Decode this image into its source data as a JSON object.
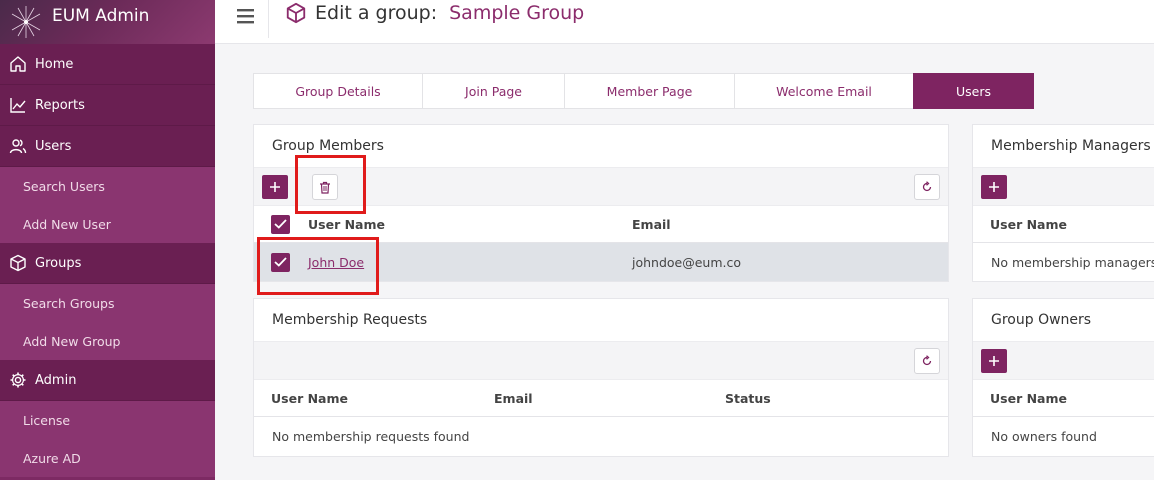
{
  "sidebar": {
    "brand": "EUM Admin",
    "nav": [
      {
        "type": "main",
        "icon": "home-icon",
        "label": "Home"
      },
      {
        "type": "main",
        "icon": "reports-icon",
        "label": "Reports"
      },
      {
        "type": "main",
        "icon": "users-icon",
        "label": "Users"
      },
      {
        "type": "sub",
        "label": "Search Users"
      },
      {
        "type": "sub",
        "label": "Add New User"
      },
      {
        "type": "main",
        "icon": "cube-icon",
        "label": "Groups"
      },
      {
        "type": "sub",
        "label": "Search Groups"
      },
      {
        "type": "sub",
        "label": "Add New Group"
      },
      {
        "type": "main",
        "icon": "gear-icon",
        "label": "Admin"
      },
      {
        "type": "sub",
        "label": "License"
      },
      {
        "type": "sub",
        "label": "Azure AD"
      }
    ]
  },
  "header": {
    "title_prefix": "Edit a group:",
    "group_name": "Sample Group"
  },
  "tabs": [
    {
      "label": "Group Details",
      "active": false
    },
    {
      "label": "Join Page",
      "active": false
    },
    {
      "label": "Member Page",
      "active": false
    },
    {
      "label": "Welcome Email",
      "active": false
    },
    {
      "label": "Users",
      "active": true
    }
  ],
  "group_members": {
    "title": "Group Members",
    "columns": [
      "User Name",
      "Email"
    ],
    "rows": [
      {
        "user_name": "John Doe",
        "email": "johndoe@eum.co",
        "selected": true
      }
    ]
  },
  "membership_requests": {
    "title": "Membership Requests",
    "columns": [
      "User Name",
      "Email",
      "Status"
    ],
    "empty": "No membership requests found"
  },
  "membership_managers": {
    "title": "Membership Managers",
    "columns": [
      "User Name"
    ],
    "empty": "No membership managers fo"
  },
  "group_owners": {
    "title": "Group Owners",
    "columns": [
      "User Name"
    ],
    "empty": "No owners found"
  },
  "colors": {
    "brand": "#7e2461",
    "sidebar": "#7d2a63",
    "highlight": "#e01b1b"
  }
}
